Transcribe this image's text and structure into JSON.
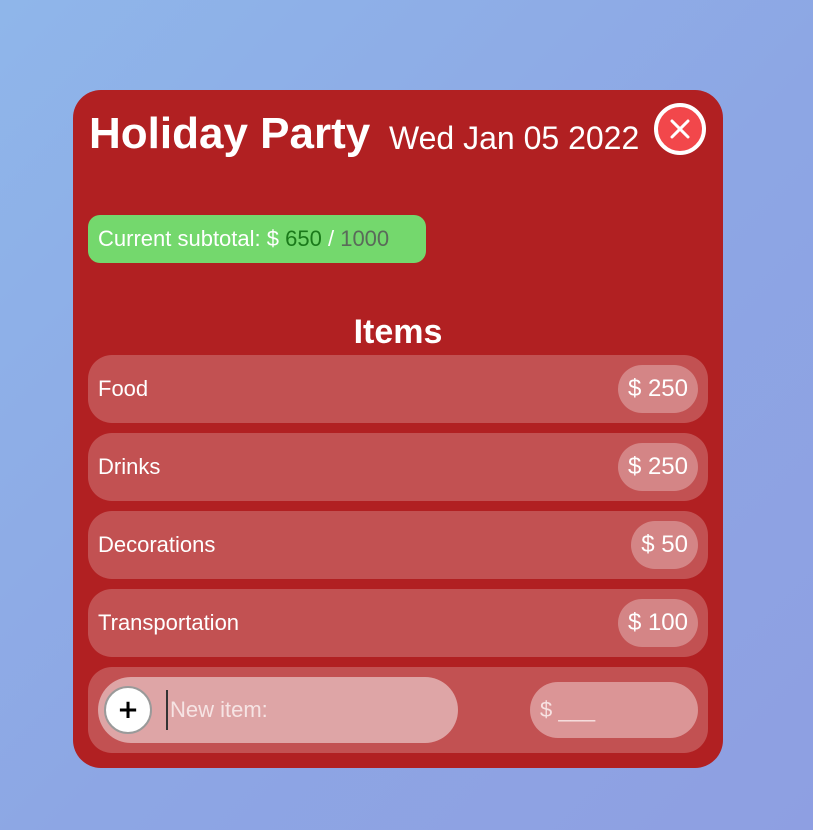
{
  "event": {
    "title": "Holiday Party",
    "date": "Wed Jan 05 2022"
  },
  "subtotal": {
    "label": "Current subtotal: $",
    "current": "650",
    "separator": "/",
    "budget": "1000"
  },
  "items_heading": "Items",
  "items": [
    {
      "name": "Food",
      "price": "$ 250"
    },
    {
      "name": "Drinks",
      "price": "$ 250"
    },
    {
      "name": "Decorations",
      "price": "$ 50"
    },
    {
      "name": "Transportation",
      "price": "$ 100"
    }
  ],
  "new_item": {
    "add_label": "+",
    "name_placeholder": "New item:",
    "price_placeholder": "$ ___"
  },
  "icons": {
    "close": "close-icon"
  },
  "colors": {
    "card": "#b12022",
    "close_button": "#f2474b",
    "subtotal_bg": "#74d86d",
    "subtotal_current": "#1a7a1a"
  }
}
